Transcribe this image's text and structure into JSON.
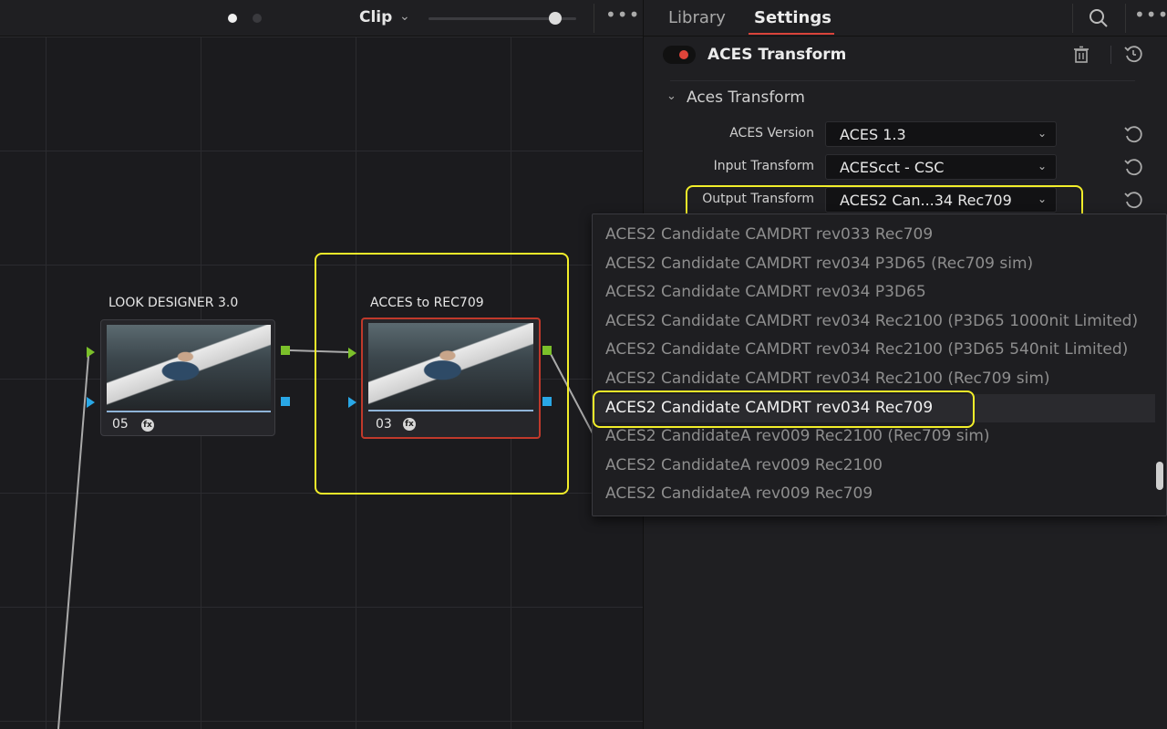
{
  "node_editor": {
    "clip_title": "Clip",
    "nodes": [
      {
        "label": "LOOK DESIGNER 3.0",
        "number": "05"
      },
      {
        "label": "ACCES to REC709",
        "number": "03"
      }
    ],
    "zoom_level": 0.86
  },
  "inspector": {
    "tabs": {
      "library": "Library",
      "settings": "Settings"
    },
    "effect_title": "ACES Transform",
    "section_title": "Aces Transform",
    "params": {
      "aces_version": {
        "label": "ACES Version",
        "value": "ACES 1.3"
      },
      "input_transform": {
        "label": "Input Transform",
        "value": "ACEScct - CSC"
      },
      "output_transform": {
        "label": "Output Transform",
        "value": "ACES2 Can...34 Rec709"
      }
    }
  },
  "dropdown": {
    "items": [
      "ACES2 Candidate CAMDRT rev033 Rec709",
      "ACES2 Candidate CAMDRT rev034 P3D65 (Rec709 sim)",
      "ACES2 Candidate CAMDRT rev034 P3D65",
      "ACES2 Candidate CAMDRT rev034 Rec2100 (P3D65 1000nit Limited)",
      "ACES2 Candidate CAMDRT rev034 Rec2100 (P3D65 540nit Limited)",
      "ACES2 Candidate CAMDRT rev034 Rec2100 (Rec709 sim)",
      "ACES2 Candidate CAMDRT rev034 Rec709",
      "ACES2 CandidateA rev009 Rec2100 (Rec709 sim)",
      "ACES2 CandidateA rev009 Rec2100",
      "ACES2 CandidateA rev009 Rec709"
    ],
    "selected_index": 6
  },
  "colors": {
    "highlight": "#f2ee2a",
    "accent_red": "#d9433a",
    "port_green": "#7bc02a",
    "port_blue": "#29a7e6"
  }
}
